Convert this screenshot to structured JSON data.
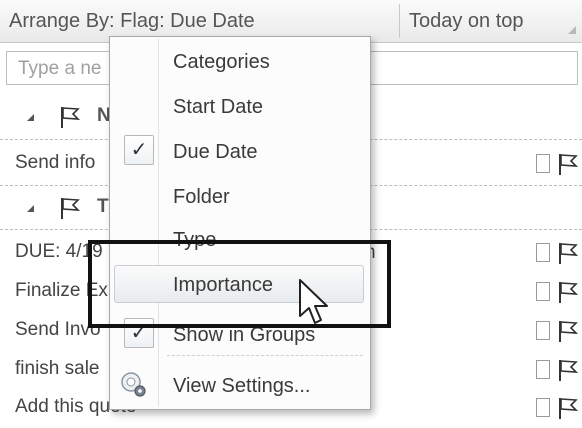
{
  "header": {
    "arrange_label": "Arrange By: Flag: Due Date",
    "sort_label": "Today on top"
  },
  "search": {
    "placeholder": "Type a ne"
  },
  "groups": [
    {
      "label": "N"
    },
    {
      "label": "T"
    }
  ],
  "tasks": [
    {
      "text": "Send info"
    },
    {
      "text": "DUE: 4/19"
    },
    {
      "text": "Finalize Ex"
    },
    {
      "text": "Send Invo"
    },
    {
      "text": "finish sale"
    },
    {
      "text": "Add this quote"
    }
  ],
  "stray_text": "n",
  "menu": {
    "items": [
      {
        "label": "Categories",
        "checked": false
      },
      {
        "label": "Start Date",
        "checked": false
      },
      {
        "label": "Due Date",
        "checked": true
      },
      {
        "label": "Folder",
        "checked": false
      },
      {
        "label": "Type",
        "checked": false
      },
      {
        "label": "Importance",
        "checked": false,
        "highlighted": true
      },
      {
        "label": "Show in Groups",
        "checked": true
      },
      {
        "label": "View Settings...",
        "icon": "settings-gear-icon"
      }
    ],
    "check_glyph": "✓"
  },
  "colors": {
    "focus_outline": "#111111",
    "highlight": "#e8ecef"
  }
}
